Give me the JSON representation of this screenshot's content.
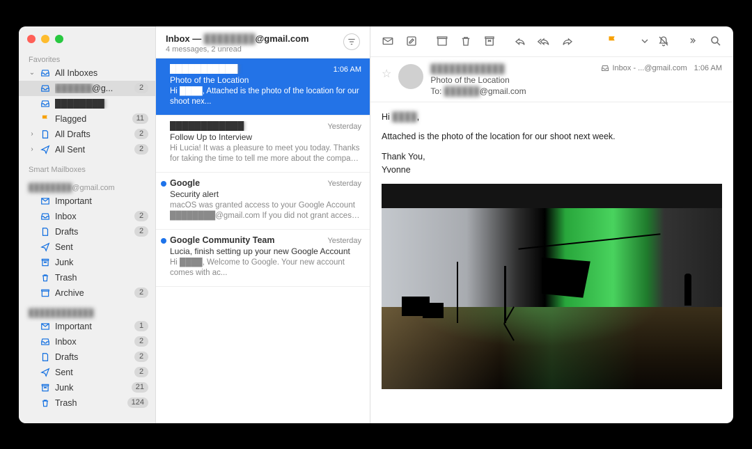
{
  "window": {
    "title_prefix": "Inbox — ",
    "account_suffix": "@gmail.com",
    "account_blur": "████████",
    "subtitle": "4 messages, 2 unread"
  },
  "sidebar": {
    "favorites_label": "Favorites",
    "smart_label": "Smart Mailboxes",
    "account_suffix": "@gmail.com",
    "account_blur": "████████",
    "all_inboxes": "All Inboxes",
    "child_account_suffix": "@g...",
    "child_account_blur": "██████",
    "child_blur2": "████████",
    "child1_count": "2",
    "flagged": "Flagged",
    "flagged_count": "11",
    "all_drafts": "All Drafts",
    "all_drafts_count": "2",
    "all_sent": "All Sent",
    "all_sent_count": "2",
    "folders1": [
      {
        "label": "Important",
        "count": ""
      },
      {
        "label": "Inbox",
        "count": "2"
      },
      {
        "label": "Drafts",
        "count": "2"
      },
      {
        "label": "Sent",
        "count": ""
      },
      {
        "label": "Junk",
        "count": ""
      },
      {
        "label": "Trash",
        "count": ""
      },
      {
        "label": "Archive",
        "count": "2"
      }
    ],
    "account2_blur": "████████████",
    "folders2": [
      {
        "label": "Important",
        "count": "1"
      },
      {
        "label": "Inbox",
        "count": "2"
      },
      {
        "label": "Drafts",
        "count": "2"
      },
      {
        "label": "Sent",
        "count": "2"
      },
      {
        "label": "Junk",
        "count": "21"
      },
      {
        "label": "Trash",
        "count": "124"
      }
    ]
  },
  "messages": [
    {
      "unread": false,
      "sender": "███████████",
      "time": "1:06 AM",
      "subject": "Photo of the Location",
      "preview": "Hi ████, Attached is the photo of the location for our shoot nex...",
      "selected": true
    },
    {
      "unread": false,
      "sender": "████████████",
      "time": "Yesterday",
      "subject": "Follow Up to Interview",
      "preview": "Hi Lucia! It was a pleasure to meet you today. Thanks for taking the time to tell me more about the company and the position. I...",
      "selected": false
    },
    {
      "unread": true,
      "sender": "Google",
      "time": "Yesterday",
      "subject": "Security alert",
      "preview": "macOS was granted access to your Google Account ████████@gmail.com If you did not grant access, you should c...",
      "selected": false
    },
    {
      "unread": true,
      "sender": "Google Community Team",
      "time": "Yesterday",
      "subject": "Lucia, finish setting up your new Google Account",
      "preview": "Hi ████, Welcome to Google. Your new account comes with ac...",
      "selected": false
    }
  ],
  "reader": {
    "from_blur": "████████████",
    "subject": "Photo of the Location",
    "to_prefix": "To: ",
    "to_blur": "██████",
    "to_suffix": "@gmail.com",
    "mailbox": "Inbox - ...@gmail.com",
    "time": "1:06 AM",
    "greeting_prefix": "Hi ",
    "greeting_blur": "████",
    "greeting_suffix": ",",
    "line2": "Attached is the photo of the location for our shoot next week.",
    "thanks": "Thank You,",
    "signature": "Yvonne"
  }
}
